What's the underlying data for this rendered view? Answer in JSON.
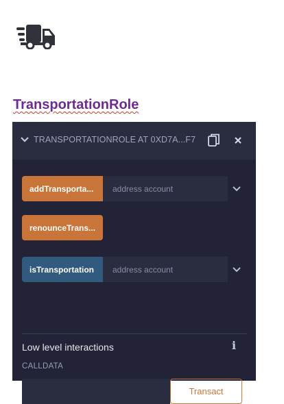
{
  "title": "TransportationRole",
  "header": {
    "title": "TRANSPORTATIONROLE AT 0XD7A...F7",
    "icons": [
      "chevron-down-icon",
      "copy-icon",
      "close-icon"
    ]
  },
  "functions": [
    {
      "label": "addTransporta...",
      "placeholder": "address account",
      "color": "#c97539"
    },
    {
      "label": "renounceTrans...",
      "color": "#c97539"
    },
    {
      "label": "isTransportation",
      "placeholder": "address account",
      "color": "#325a7e"
    }
  ],
  "low_level": {
    "title": "Low level interactions",
    "calldata_label": "CALLDATA",
    "transact_label": "Transact"
  },
  "colors": {
    "panel": "#2a2c3f",
    "inner": "#222336",
    "accent": "#c97539",
    "title": "#6f2a91"
  }
}
